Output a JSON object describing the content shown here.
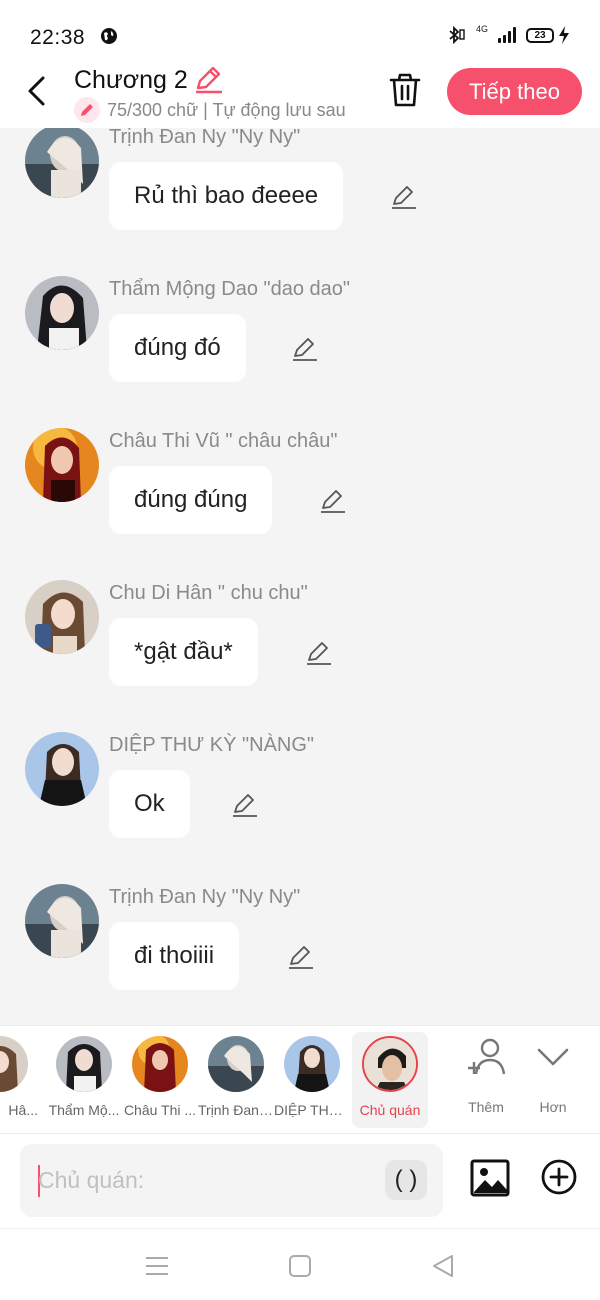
{
  "status_bar": {
    "time": "22:38",
    "network_label": "4G",
    "battery": "23",
    "icons": [
      "globe-icon",
      "bluetooth-icon",
      "signal-icon",
      "battery-icon",
      "charging-icon"
    ]
  },
  "header": {
    "title": "Chương 2",
    "subtitle": "75/300 chữ | Tự động lưu sau",
    "next_label": "Tiếp theo",
    "accent_color": "#f6506c"
  },
  "messages": [
    {
      "sender": "Trịnh Đan Ny \"Ny Ny\"",
      "text": "Rủ thì bao đeeee"
    },
    {
      "sender": "Thẩm Mộng Dao \"dao dao\"",
      "text": "đúng đó"
    },
    {
      "sender": "Châu Thi Vũ \" châu châu\"",
      "text": "đúng đúng"
    },
    {
      "sender": "Chu Di Hân \" chu chu\"",
      "text": "*gật đầu*"
    },
    {
      "sender": "DIỆP THƯ KỲ \"NÀNG\"",
      "text": "Ok"
    },
    {
      "sender": "Trịnh Đan Ny \"Ny Ny\"",
      "text": "đi thoiiii"
    }
  ],
  "characters": [
    {
      "label": "Hâ..."
    },
    {
      "label": "Thẩm Mộ..."
    },
    {
      "label": "Châu Thi ..."
    },
    {
      "label": "Trịnh Đan ..."
    },
    {
      "label": "DIỆP THƯ ..."
    },
    {
      "label": "Chủ quán",
      "active": true
    }
  ],
  "strip_buttons": {
    "add_label": "Thêm",
    "more_label": "Hơn"
  },
  "input": {
    "placeholder": "Chủ quán:",
    "paren_label": "( )"
  }
}
